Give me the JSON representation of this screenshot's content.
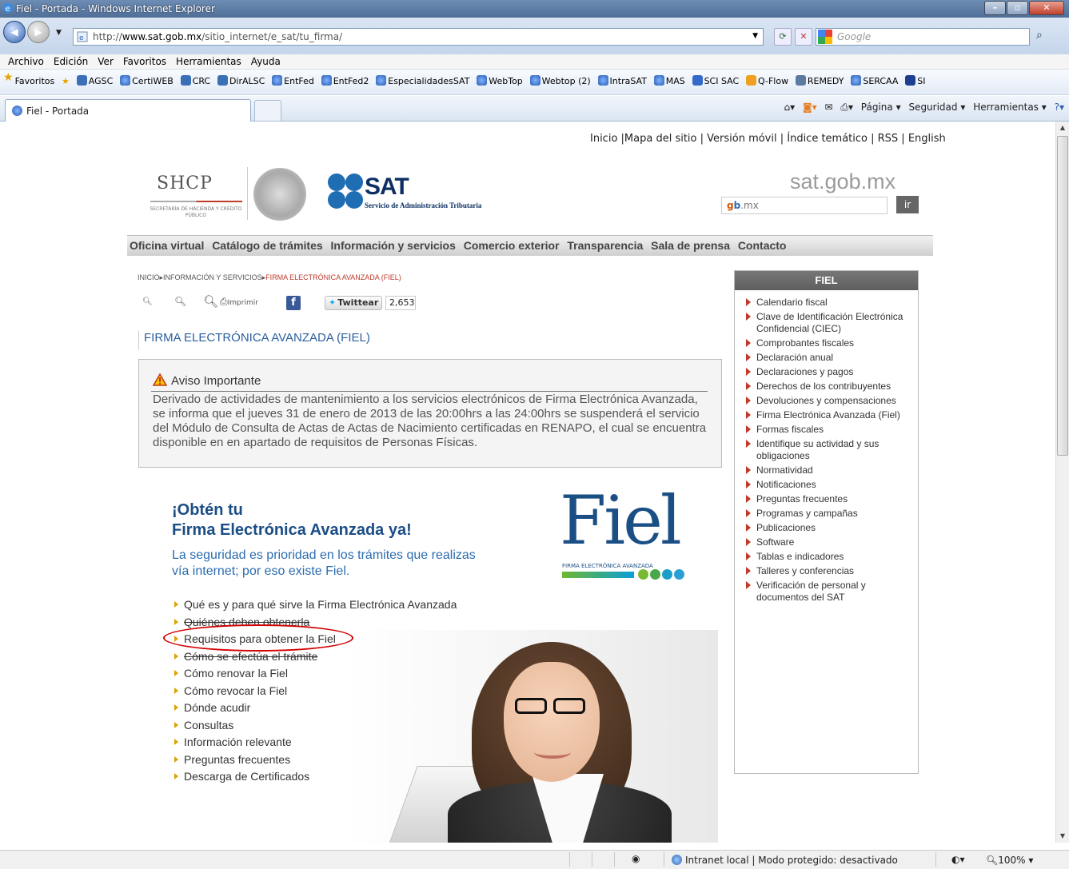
{
  "browser": {
    "window_title": "Fiel - Portada - Windows Internet Explorer",
    "url_prefix": "http://",
    "url_host": "www.sat.gob.mx",
    "url_path": "/sitio_internet/e_sat/tu_firma/",
    "search_placeholder": "Google",
    "menu": [
      "Archivo",
      "Edición",
      "Ver",
      "Favoritos",
      "Herramientas",
      "Ayuda"
    ],
    "favorites_label": "Favoritos",
    "favorites": [
      {
        "label": "AGSC",
        "icon": "sharepoint-icon"
      },
      {
        "label": "CertiWEB",
        "icon": "ie-page-icon"
      },
      {
        "label": "CRC",
        "icon": "sharepoint-icon"
      },
      {
        "label": "DirALSC",
        "icon": "sharepoint-icon"
      },
      {
        "label": "EntFed",
        "icon": "ie-page-icon"
      },
      {
        "label": "EntFed2",
        "icon": "ie-page-icon"
      },
      {
        "label": "EspecialidadesSAT",
        "icon": "ie-page-icon"
      },
      {
        "label": "WebTop",
        "icon": "ie-page-icon"
      },
      {
        "label": "Webtop (2)",
        "icon": "ie-page-icon"
      },
      {
        "label": "IntraSAT",
        "icon": "ie-page-icon"
      },
      {
        "label": "MAS",
        "icon": "ie-page-icon"
      },
      {
        "label": "SCI SAC",
        "icon": "flag-icon"
      },
      {
        "label": "Q-Flow",
        "icon": "qflow-icon"
      },
      {
        "label": "REMEDY",
        "icon": "remedy-icon"
      },
      {
        "label": "SERCAA",
        "icon": "ie-page-icon"
      },
      {
        "label": "SI",
        "icon": "sharepoint-icon"
      }
    ],
    "tab_title": "Fiel - Portada",
    "command_bar": [
      "Página ▾",
      "Seguridad ▾",
      "Herramientas ▾"
    ],
    "status_zone": "Intranet local | Modo protegido: desactivado",
    "zoom": "100%"
  },
  "page": {
    "top_links": "Inicio |Mapa del sitio | Versión móvil | Índice temático | RSS | English",
    "shcp": {
      "name": "SHCP",
      "subtitle": "SECRETARÍA DE HACIENDA Y CRÉDITO PÚBLICO"
    },
    "sat": {
      "name": "SAT",
      "subtitle": "Servicio de Administración Tributaria"
    },
    "domain_bold": "sat",
    "domain_rest": ".gob.mx",
    "gob_logo_left": "g",
    "gob_logo_mid": "b",
    "gob_logo_right": ".mx",
    "go_button": "ir",
    "nav": [
      "Oficina virtual",
      "Catálogo de trámites",
      "Información y servicios",
      "Comercio exterior",
      "Transparencia",
      "Sala de prensa",
      "Contacto"
    ],
    "breadcrumb": {
      "a": "INICIO",
      "b": "INFORMACIÓN Y SERVICIOS",
      "c": "FIRMA ELECTRÓNICA AVANZADA (FIEL)"
    },
    "print_label": "Imprimir",
    "tweet_label": "Twittear",
    "tweet_count": "2,653",
    "title": "FIRMA ELECTRÓNICA AVANZADA (FIEL)",
    "notice": {
      "heading": "Aviso Importante",
      "body": "Derivado de actividades de mantenimiento a los servicios electrónicos de Firma Electrónica Avanzada, se informa que el jueves 31 de enero de 2013 de las 20:00hrs a las 24:00hrs se suspenderá el servicio del Módulo de Consulta de Actas de Actas de Nacimiento certificadas en RENAPO, el cual se encuentra disponible en en apartado de requisitos de Personas Físicas."
    },
    "promo": {
      "line1": "¡Obtén tu",
      "line2": "Firma Electrónica Avanzada ya!",
      "text": "La seguridad es prioridad en los trámites que realizas vía internet; por eso existe Fiel."
    },
    "fiel_logo": {
      "word": "Fiel",
      "tagline": "FIRMA ELECTRÓNICA AVANZADA"
    },
    "links": [
      "Qué es y para qué sirve la Firma Electrónica Avanzada",
      "Quiénes deben obtenerla",
      "Requisitos para obtener la Fiel",
      "Cómo se efectúa el trámite",
      "Cómo renovar la Fiel",
      "Cómo revocar la Fiel",
      "Dónde acudir",
      "Consultas",
      "Información relevante",
      "Preguntas frecuentes",
      "Descarga de Certificados"
    ],
    "sidebar": {
      "title": "FIEL",
      "items": [
        "Calendario fiscal",
        "Clave de Identificación Electrónica Confidencial (CIEC)",
        "Comprobantes fiscales",
        "Declaración anual",
        "Declaraciones y pagos",
        "Derechos de los contribuyentes",
        "Devoluciones y compensaciones",
        "Firma Electrónica Avanzada (Fiel)",
        "Formas fiscales",
        "Identifique su actividad y sus obligaciones",
        "Normatividad",
        "Notificaciones",
        "Preguntas frecuentes",
        "Programas y campañas",
        "Publicaciones",
        "Software",
        "Tablas e indicadores",
        "Talleres y conferencias",
        "Verificación de personal y documentos del SAT"
      ]
    }
  },
  "colors": {
    "accent_blue": "#1b4d86",
    "link_red": "#c0392b",
    "highlight_circle": "#d10000"
  }
}
